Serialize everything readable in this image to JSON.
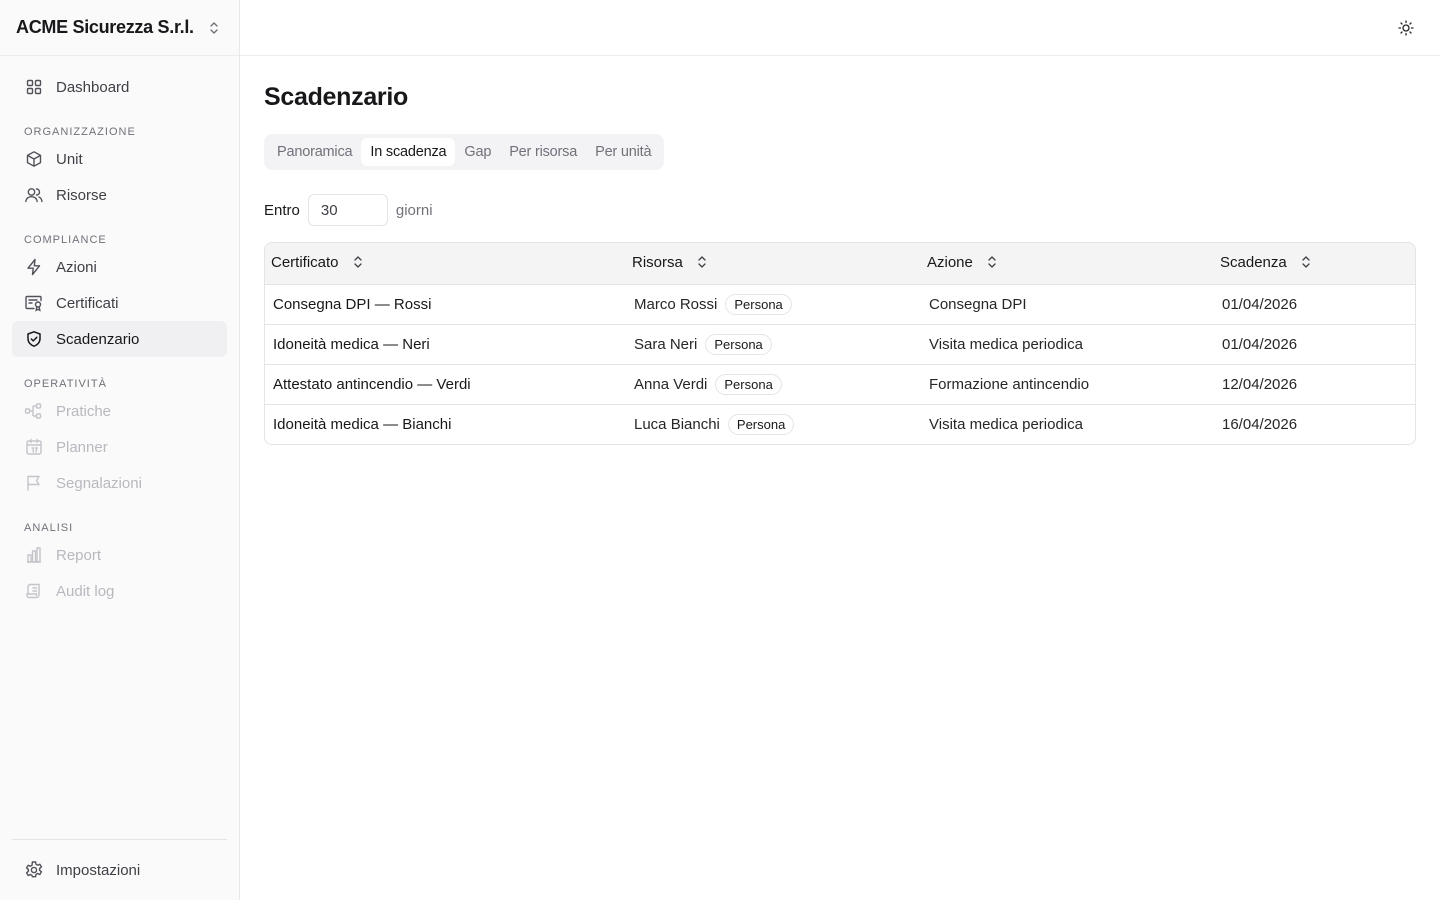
{
  "org": {
    "name": "ACME Sicurezza S.r.l."
  },
  "sidebar": {
    "dashboard": "Dashboard",
    "sections": {
      "organizzazione": "ORGANIZZAZIONE",
      "compliance": "COMPLIANCE",
      "operativita": "OPERATIVITÀ",
      "analisi": "ANALISI"
    },
    "items": {
      "unit": "Unit",
      "risorse": "Risorse",
      "azioni": "Azioni",
      "certificati": "Certificati",
      "scadenzario": "Scadenzario",
      "pratiche": "Pratiche",
      "planner": "Planner",
      "segnalazioni": "Segnalazioni",
      "report": "Report",
      "audit_log": "Audit log"
    },
    "settings": "Impostazioni"
  },
  "page": {
    "title": "Scadenzario"
  },
  "tabs": [
    {
      "label": "Panoramica"
    },
    {
      "label": "In scadenza"
    },
    {
      "label": "Gap"
    },
    {
      "label": "Per risorsa"
    },
    {
      "label": "Per unità"
    }
  ],
  "filter": {
    "label": "Entro",
    "value": "30",
    "unit": "giorni"
  },
  "table": {
    "headers": [
      "Certificato",
      "Risorsa",
      "Azione",
      "Scadenza"
    ],
    "rows": [
      {
        "certificato": "Consegna DPI — Rossi",
        "risorsa": "Marco Rossi",
        "tipo": "Persona",
        "azione": "Consegna DPI",
        "scadenza": "01/04/2026"
      },
      {
        "certificato": "Idoneità medica — Neri",
        "risorsa": "Sara Neri",
        "tipo": "Persona",
        "azione": "Visita medica periodica",
        "scadenza": "01/04/2026"
      },
      {
        "certificato": "Attestato antincendio — Verdi",
        "risorsa": "Anna Verdi",
        "tipo": "Persona",
        "azione": "Formazione antincendio",
        "scadenza": "12/04/2026"
      },
      {
        "certificato": "Idoneità medica — Bianchi",
        "risorsa": "Luca Bianchi",
        "tipo": "Persona",
        "azione": "Visita medica periodica",
        "scadenza": "16/04/2026"
      }
    ]
  }
}
